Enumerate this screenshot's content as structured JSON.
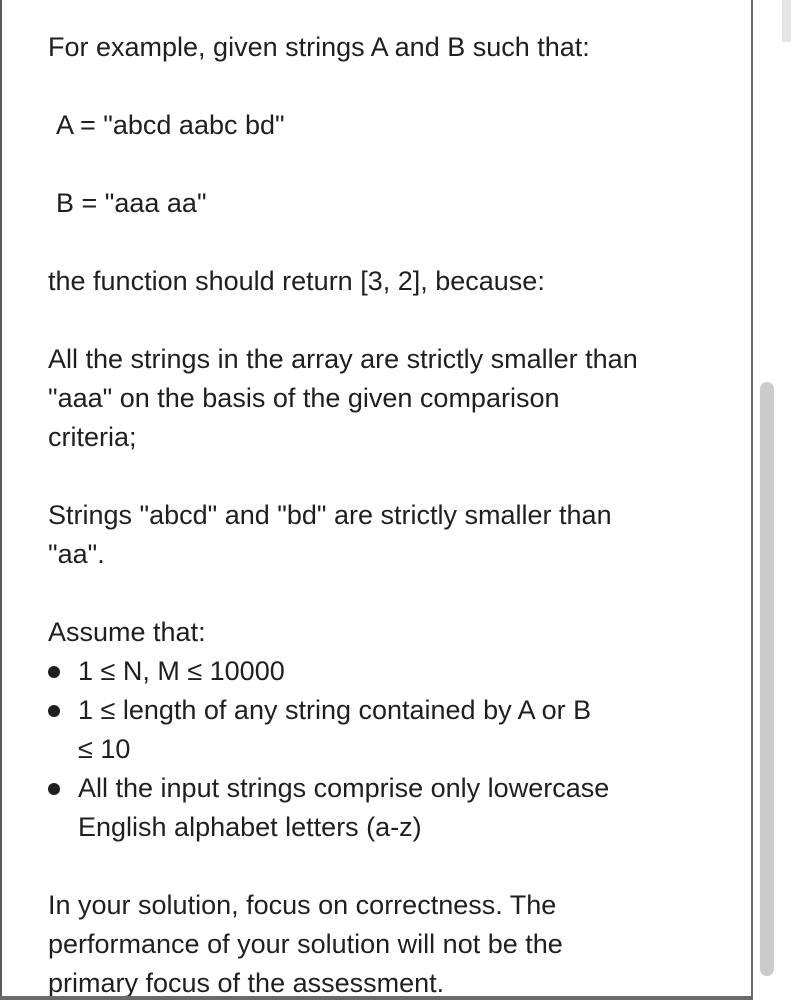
{
  "document": {
    "intro": "For example, given strings A and B such that:",
    "code_a": "A = \"abcd aabc bd\"",
    "code_b": "B = \"aaa aa\"",
    "return_line": "the function should return [3, 2], because:",
    "reason1_line1": "All the strings in the array are strictly smaller than",
    "reason1_line2": "\"aaa\" on the basis of the given comparison",
    "reason1_line3": "criteria;",
    "reason2_line1": "Strings \"abcd\" and \"bd\" are strictly smaller than",
    "reason2_line2": "\"aa\".",
    "assume": "Assume that:",
    "bullets": [
      {
        "line1": "1 ≤ N, M ≤ 10000"
      },
      {
        "line1": "1 ≤ length of any string contained by A or B",
        "line2": "≤ 10"
      },
      {
        "line1": "All the input strings comprise only lowercase",
        "line2": "English alphabet letters (a-z)"
      }
    ],
    "closing_line1": "In your solution, focus on correctness. The",
    "closing_line2": "performance of your solution will not be the",
    "closing_line3": "primary focus of the assessment."
  }
}
